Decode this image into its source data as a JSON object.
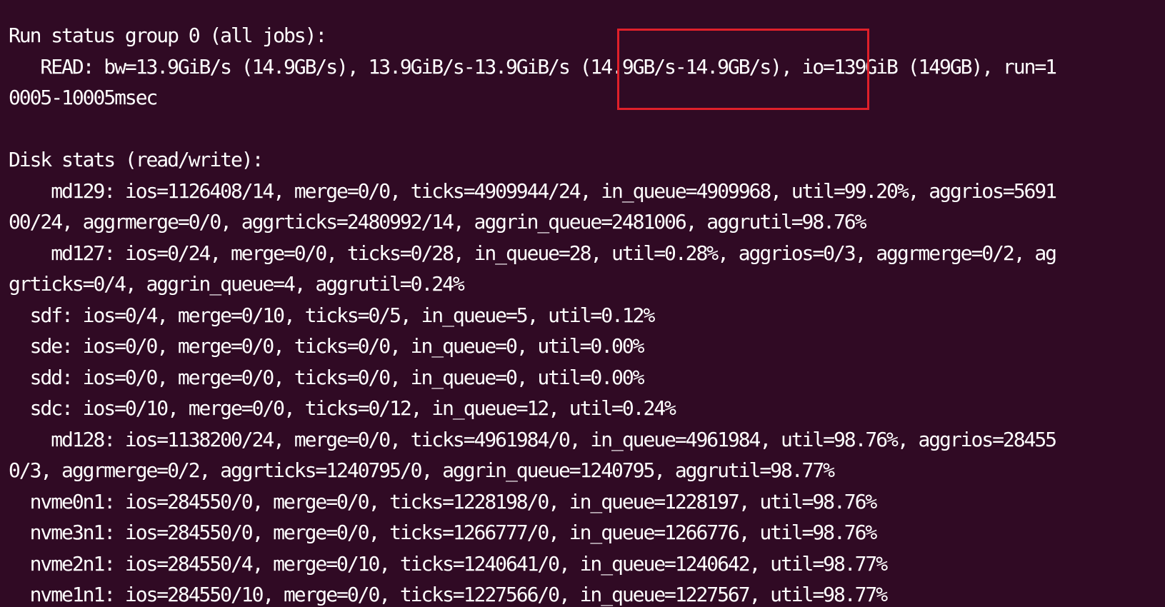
{
  "terminal": {
    "lines": [
      "Run status group 0 (all jobs):",
      "   READ: bw=13.9GiB/s (14.9GB/s), 13.9GiB/s-13.9GiB/s (14.9GB/s-14.9GB/s), io=139GiB (149GB), run=1",
      "0005-10005msec",
      "",
      "Disk stats (read/write):",
      "    md129: ios=1126408/14, merge=0/0, ticks=4909944/24, in_queue=4909968, util=99.20%, aggrios=5691",
      "00/24, aggrmerge=0/0, aggrticks=2480992/14, aggrin_queue=2481006, aggrutil=98.76%",
      "    md127: ios=0/24, merge=0/0, ticks=0/28, in_queue=28, util=0.28%, aggrios=0/3, aggrmerge=0/2, ag",
      "grticks=0/4, aggrin_queue=4, aggrutil=0.24%",
      "  sdf: ios=0/4, merge=0/10, ticks=0/5, in_queue=5, util=0.12%",
      "  sde: ios=0/0, merge=0/0, ticks=0/0, in_queue=0, util=0.00%",
      "  sdd: ios=0/0, merge=0/0, ticks=0/0, in_queue=0, util=0.00%",
      "  sdc: ios=0/10, merge=0/0, ticks=0/12, in_queue=12, util=0.24%",
      "    md128: ios=1138200/24, merge=0/0, ticks=4961984/0, in_queue=4961984, util=98.76%, aggrios=28455",
      "0/3, aggrmerge=0/2, aggrticks=1240795/0, aggrin_queue=1240795, aggrutil=98.77%",
      "  nvme0n1: ios=284550/0, merge=0/0, ticks=1228198/0, in_queue=1228197, util=98.76%",
      "  nvme3n1: ios=284550/0, merge=0/0, ticks=1266777/0, in_queue=1266776, util=98.76%",
      "  nvme2n1: ios=284550/4, merge=0/10, ticks=1240641/0, in_queue=1240642, util=98.77%",
      "  nvme1n1: ios=284550/10, merge=0/0, ticks=1227566/0, in_queue=1227567, util=98.77%"
    ]
  },
  "colors": {
    "background": "#300a24",
    "text": "#ffffff",
    "highlight_border": "#e0202a"
  }
}
